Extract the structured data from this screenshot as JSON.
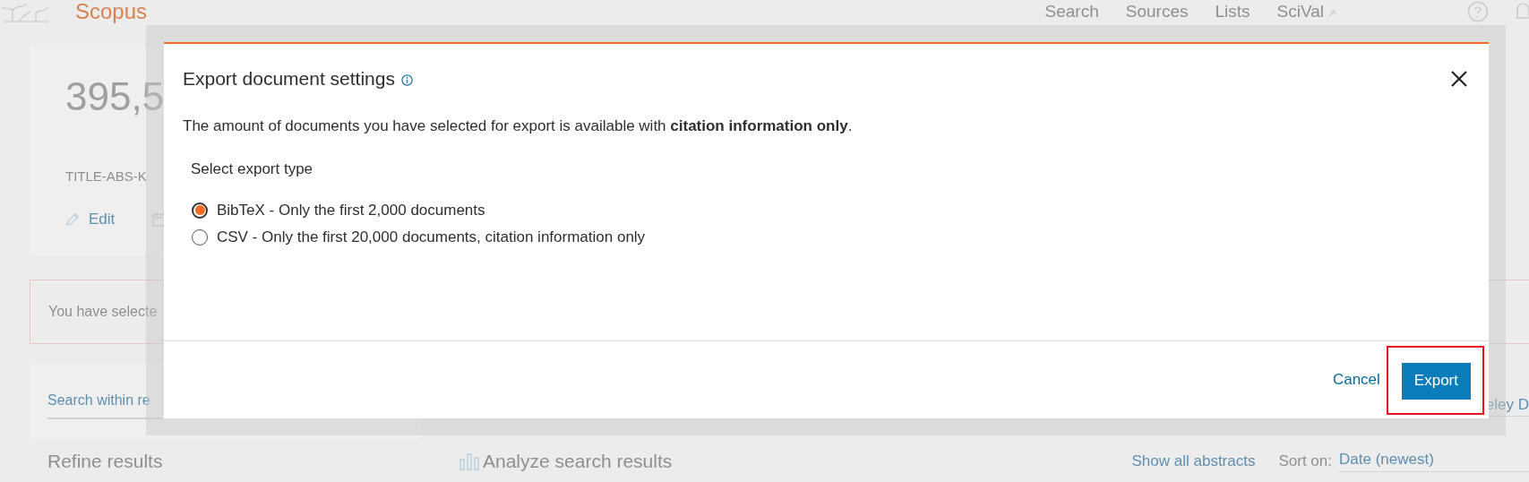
{
  "header": {
    "brand": "Scopus",
    "nav": [
      {
        "label": "Search",
        "external": false
      },
      {
        "label": "Sources",
        "external": false
      },
      {
        "label": "Lists",
        "external": false
      },
      {
        "label": "SciVal",
        "external": true
      }
    ]
  },
  "results": {
    "count": "395,5",
    "query": "TITLE-ABS-K",
    "action": "Edit",
    "notice": "You have selecte",
    "search_within": {
      "placeholder": "Search within re"
    },
    "refine_title": "Refine results",
    "column_3": "eley D",
    "analyze": "Analyze search results",
    "show_abstracts": "Show all abstracts",
    "sort_label": "Sort on:",
    "sort_value": "Date (newest)"
  },
  "dialog": {
    "title": "Export document settings",
    "message": "The amount of documents you have selected for export is available with **citation information only**.",
    "prompt": "Select export type",
    "options": [
      {
        "label": "BibTeX - Only the first 2,000 documents",
        "selected": true
      },
      {
        "label": "CSV - Only the first 20,000 documents, citation information only",
        "selected": false
      }
    ],
    "cancel": "Cancel",
    "export": {
      "label": "Export",
      "highlighted": true
    }
  }
}
